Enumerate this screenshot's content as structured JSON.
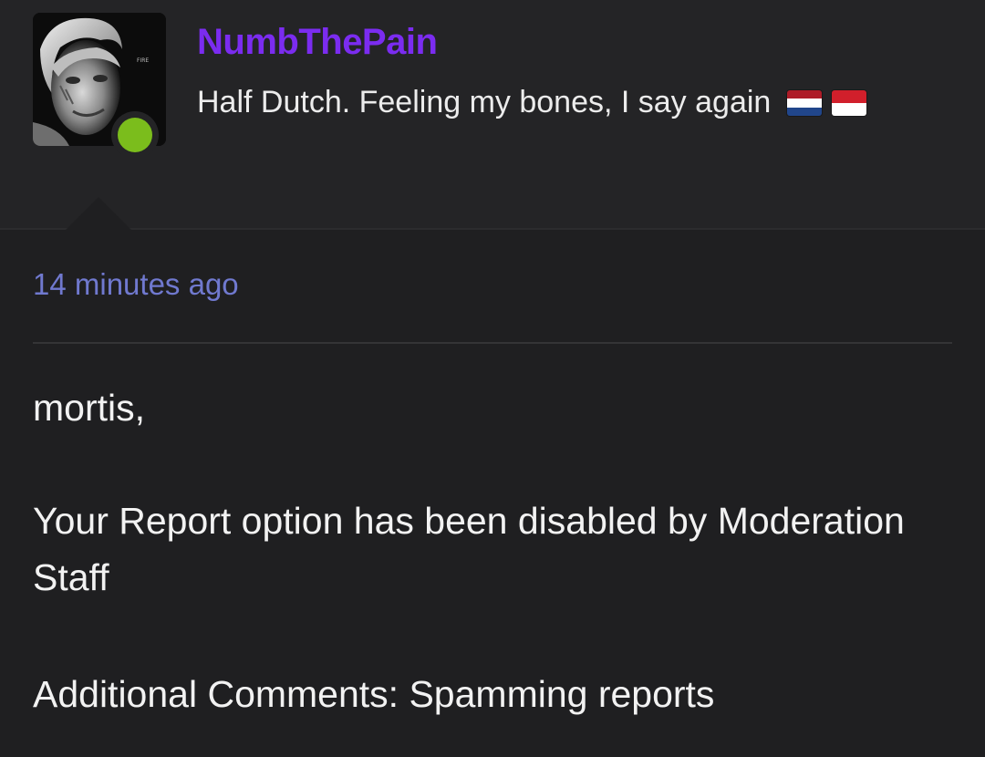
{
  "profile": {
    "username": "NumbThePain",
    "bio": "Half Dutch. Feeling my bones, I say again",
    "bio_flags": [
      "flag-netherlands-icon",
      "flag-indonesia-icon"
    ],
    "online_status": "online",
    "avatar_text": "FIRE"
  },
  "message": {
    "timestamp": "14 minutes ago",
    "greeting": "mortis,",
    "notice": "Your Report option has been disabled by Moderation Staff",
    "comments": "Additional Comments: Spamming reports"
  },
  "colors": {
    "username": "#7b2cf0",
    "timestamp": "#7079cf",
    "online": "#7bbd1c",
    "background": "#242426",
    "message_background": "#1f1f21"
  }
}
